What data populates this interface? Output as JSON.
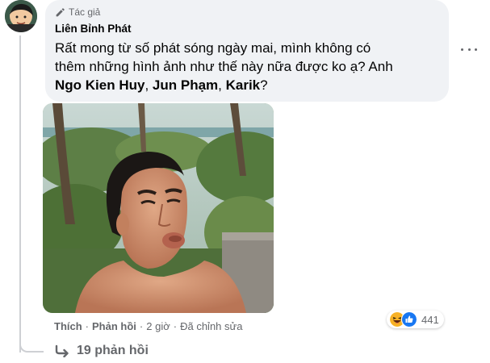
{
  "comment": {
    "author_badge": "Tác giả",
    "author_name": "Liên Bỉnh Phát",
    "text_line1": "Rất mong từ số phát sóng ngày mai, mình không có",
    "text_line2": "thêm những hình ảnh như thế này nữa được ko ạ? Anh",
    "mentions": [
      "Ngo Kien Huy",
      "Jun Phạm",
      "Karik"
    ],
    "separator": ", ",
    "ending": "?"
  },
  "actions": {
    "like": "Thích",
    "reply": "Phản hồi",
    "time": "2 giờ",
    "edited": "Đã chỉnh sửa",
    "dot": "·"
  },
  "reactions": {
    "icons": [
      "haha-icon",
      "like-icon"
    ],
    "count": "441",
    "colors": {
      "like": "#1877f2",
      "haha": "#f7b125"
    }
  },
  "replies": {
    "label": "19 phản hồi"
  },
  "colors": {
    "bubble": "#f0f2f5",
    "secondary_text": "#65676b",
    "primary_text": "#050505"
  }
}
